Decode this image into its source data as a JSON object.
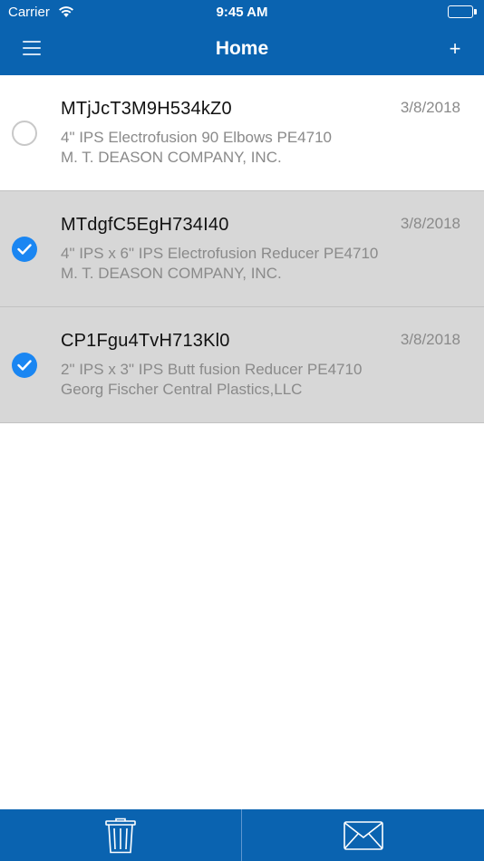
{
  "status": {
    "carrier": "Carrier",
    "time": "9:45 AM",
    "icons": [
      "wifi-icon",
      "battery-icon"
    ]
  },
  "nav": {
    "title": "Home",
    "menu_icon": "hamburger-menu-icon",
    "add_label": "+"
  },
  "items": [
    {
      "title": "MTjJcT3M9H534kZ0",
      "date": "3/8/2018",
      "description": "4\" IPS Electrofusion 90 Elbows PE4710",
      "company": "M. T. DEASON COMPANY, INC.",
      "selected": false
    },
    {
      "title": "MTdgfC5EgH734I40",
      "date": "3/8/2018",
      "description": "4\" IPS x 6\" IPS Electrofusion Reducer PE4710",
      "company": "M. T. DEASON COMPANY, INC.",
      "selected": true
    },
    {
      "title": "CP1Fgu4TvH713Kl0",
      "date": "3/8/2018",
      "description": "2\" IPS x 3\" IPS Butt fusion Reducer PE4710",
      "company": "Georg Fischer Central Plastics,LLC",
      "selected": true
    }
  ],
  "toolbar": {
    "left_icon": "trash-icon",
    "right_icon": "mail-icon"
  },
  "colors": {
    "brand_blue": "#0a63b0",
    "check_blue": "#1a86f2",
    "selected_row": "#d7d7d7"
  }
}
